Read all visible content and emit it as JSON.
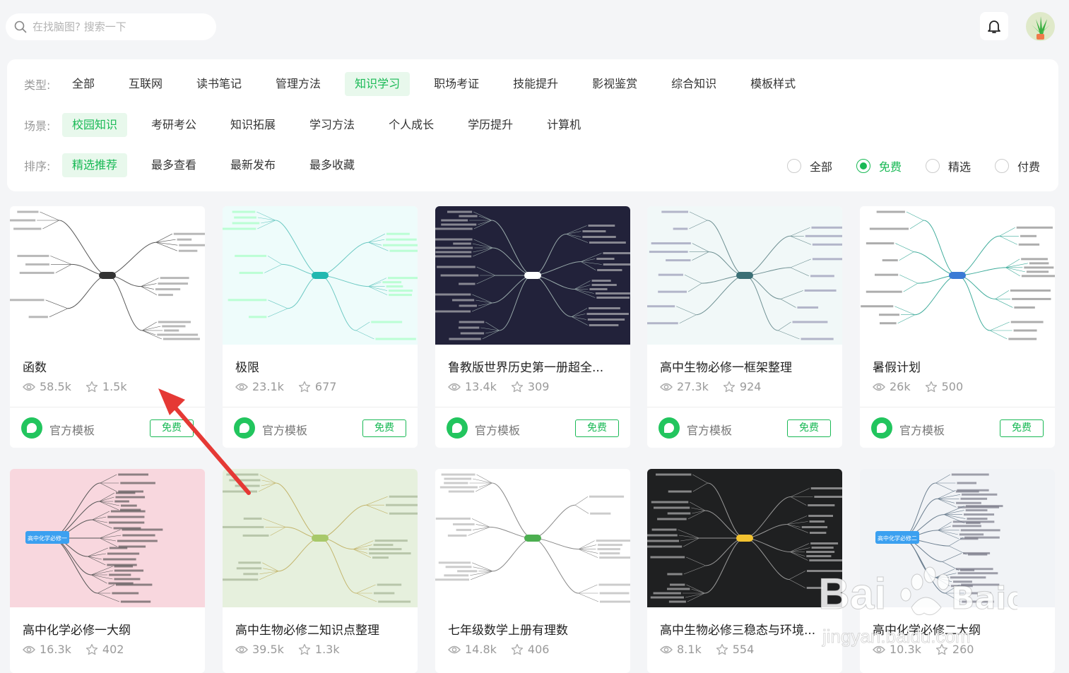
{
  "search": {
    "placeholder": "在找脑图? 搜索一下"
  },
  "filters": {
    "type_label": "类型:",
    "types": [
      "全部",
      "互联网",
      "读书笔记",
      "管理方法",
      "知识学习",
      "职场考证",
      "技能提升",
      "影视鉴赏",
      "综合知识",
      "模板样式"
    ],
    "type_active": "知识学习",
    "scene_label": "场景:",
    "scenes": [
      "校园知识",
      "考研考公",
      "知识拓展",
      "学习方法",
      "个人成长",
      "学历提升",
      "计算机"
    ],
    "scene_active": "校园知识",
    "sort_label": "排序:",
    "sorts": [
      "精选推荐",
      "最多查看",
      "最新发布",
      "最多收藏"
    ],
    "sort_active": "精选推荐",
    "price_options": [
      "全部",
      "免费",
      "精选",
      "付费"
    ],
    "price_active": "免费"
  },
  "cards": [
    {
      "title": "函数",
      "views": "58.5k",
      "stars": "1.5k",
      "author": "官方模板",
      "badge": "免费",
      "theme": "white"
    },
    {
      "title": "极限",
      "views": "23.1k",
      "stars": "677",
      "author": "官方模板",
      "badge": "免费",
      "theme": "mint"
    },
    {
      "title": "鲁教版世界历史第一册超全...",
      "views": "13.4k",
      "stars": "309",
      "author": "官方模板",
      "badge": "免费",
      "theme": "navy"
    },
    {
      "title": "高中生物必修一框架整理",
      "views": "27.3k",
      "stars": "924",
      "author": "官方模板",
      "badge": "免费",
      "theme": "pale"
    },
    {
      "title": "暑假计划",
      "views": "26k",
      "stars": "500",
      "author": "官方模板",
      "badge": "免费",
      "theme": "teal"
    },
    {
      "title": "高中化学必修一大纲",
      "views": "16.3k",
      "stars": "402",
      "theme": "pink",
      "root": "高中化学必修一"
    },
    {
      "title": "高中生物必修二知识点整理",
      "views": "39.5k",
      "stars": "1.3k",
      "theme": "green"
    },
    {
      "title": "七年级数学上册有理数",
      "views": "14.8k",
      "stars": "406",
      "theme": "white2"
    },
    {
      "title": "高中生物必修三稳态与环境...",
      "views": "8.1k",
      "stars": "554",
      "theme": "black"
    },
    {
      "title": "高中化学必修二大纲",
      "views": "10.3k",
      "stars": "260",
      "theme": "gray",
      "root": "高中化学必修二"
    }
  ],
  "watermark": {
    "brand": "Baidu 经验",
    "url": "jingyan.baidu.com"
  },
  "colors": {
    "accent": "#19b955",
    "arrow": "#e53935"
  }
}
